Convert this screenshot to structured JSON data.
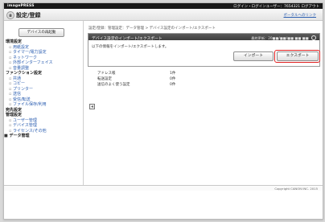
{
  "topbar": {
    "brand": "imagePRESS",
    "userinfo": "ログイン・ログインユーザー：7654321 ログアウト"
  },
  "header": {
    "title": "設定/登録",
    "portal_link": "ポータルへのリンク"
  },
  "sidebar": {
    "reset_button": "デバイスの再起動",
    "items": [
      {
        "label": "環境設定",
        "level": "cat"
      },
      {
        "label": "用紙設定",
        "level": "sub"
      },
      {
        "label": "タイマー/電力設定",
        "level": "sub"
      },
      {
        "label": "ネットワーク",
        "level": "sub"
      },
      {
        "label": "外部インターフェイス",
        "level": "sub"
      },
      {
        "label": "音量調整",
        "level": "sub"
      },
      {
        "label": "ファンクション設定",
        "level": "cat"
      },
      {
        "label": "共通",
        "level": "sub"
      },
      {
        "label": "コピー",
        "level": "sub"
      },
      {
        "label": "プリンター",
        "level": "sub"
      },
      {
        "label": "送信",
        "level": "sub"
      },
      {
        "label": "受信/転送",
        "level": "sub"
      },
      {
        "label": "ファイル保存/利用",
        "level": "sub"
      },
      {
        "label": "宛先設定",
        "level": "cat"
      },
      {
        "label": "管理設定",
        "level": "cat"
      },
      {
        "label": "ユーザー管理",
        "level": "sub"
      },
      {
        "label": "デバイス管理",
        "level": "sub"
      },
      {
        "label": "ライセンス/その他",
        "level": "sub"
      },
      {
        "label": "データ管理",
        "level": "current"
      }
    ]
  },
  "main": {
    "breadcrumb": "設定/登録：管理設定：データ管理 > デバイス設定のインポート/エクスポート",
    "panel": {
      "title": "デバイス設定のインポート/エクスポート",
      "updated": "最終更新：20■■/■■/■■ ■■:■■",
      "message": "以下の情報をインポート/エクスポートします。",
      "import_button": "インポート",
      "export_button": "エクスポート"
    },
    "rows": [
      {
        "key": "アドレス帳",
        "value": "1件"
      },
      {
        "key": "転送設定",
        "value": "0件"
      },
      {
        "key": "送信のよく使う設定",
        "value": "0件"
      }
    ]
  },
  "footer": {
    "copyright": "Copyright CANON INC. 2015"
  }
}
